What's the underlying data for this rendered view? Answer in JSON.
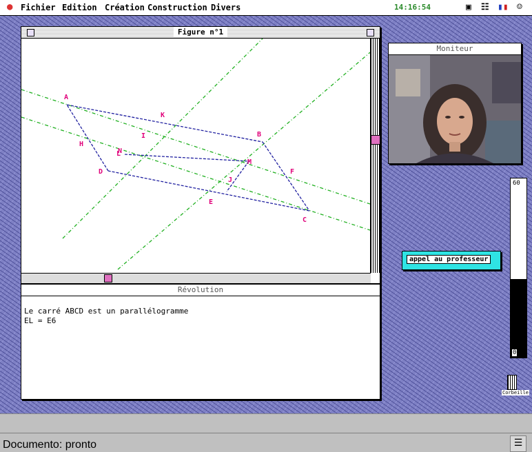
{
  "menubar": {
    "items": [
      "Fichier",
      "Edition",
      "Création",
      "Construction",
      "Divers"
    ],
    "clock": "14:16:54"
  },
  "figure_window": {
    "title": "Figure n°1",
    "points": [
      "A",
      "B",
      "C",
      "D",
      "E",
      "F",
      "H",
      "I",
      "J",
      "K",
      "L",
      "M",
      "N"
    ]
  },
  "revolution_window": {
    "title": "Révolution",
    "lines": [
      "Le carré ABCD est un parallélogramme",
      "EL = E6"
    ]
  },
  "moniteur_window": {
    "title": "Moniteur"
  },
  "call_button": {
    "label": "appel au professeur"
  },
  "level_meter": {
    "max_label": "60",
    "min_label": "0",
    "level": 0.44
  },
  "trash": {
    "label": "Corbeille"
  },
  "statusbar": {
    "message": "Documento: pronto"
  },
  "colors": {
    "desktop": "#7e80c4",
    "geometry_blue": "#2020a0",
    "geometry_green": "#20b020",
    "point_label": "#e0007a",
    "call_button": "#2fe4e4"
  }
}
